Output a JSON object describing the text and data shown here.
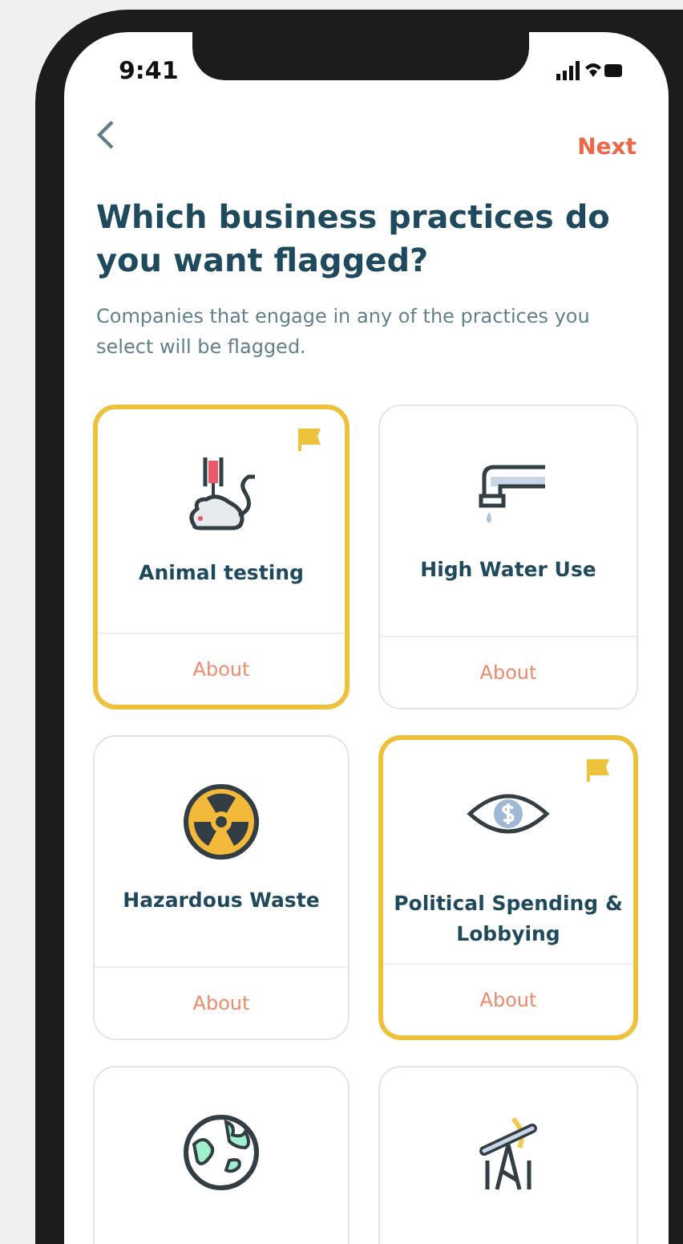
{
  "status_bar": {
    "time": "9:41"
  },
  "nav": {
    "action": "Next"
  },
  "title": "Which business practices do you want flagged?",
  "subtitle": "Companies that engage in any of the practices you select will be flagged.",
  "practices": [
    {
      "kind": "animal",
      "label": "Animal testing",
      "selected": true,
      "link": "About"
    },
    {
      "kind": "water",
      "label": "High Water Use",
      "selected": false,
      "link": "About"
    },
    {
      "kind": "hazard",
      "label": "Hazardous Waste",
      "selected": false,
      "link": "About"
    },
    {
      "kind": "politics",
      "label": "Political Spending & Lobbying",
      "selected": true,
      "link": "About"
    },
    {
      "kind": "globe",
      "selected": false
    },
    {
      "kind": "oil",
      "selected": false
    }
  ]
}
